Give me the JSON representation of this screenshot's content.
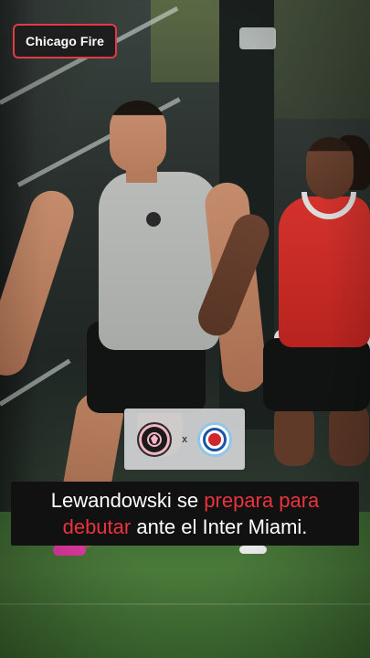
{
  "tag": {
    "label": "Chicago Fire"
  },
  "matchup": {
    "home_crest": "inter-miami-crest-icon",
    "separator": "x",
    "away_crest": "chicago-fire-crest-icon"
  },
  "caption": {
    "line1": {
      "a": "Lewandowski se ",
      "b": "prepara para"
    },
    "line2": {
      "a": "debutar",
      "b": " ante el Inter Miami."
    }
  },
  "colors": {
    "accent_red": "#e9343d",
    "tag_border": "#e23b45",
    "caption_bg": "#111111",
    "matchup_bg": "#d2d4d6"
  }
}
